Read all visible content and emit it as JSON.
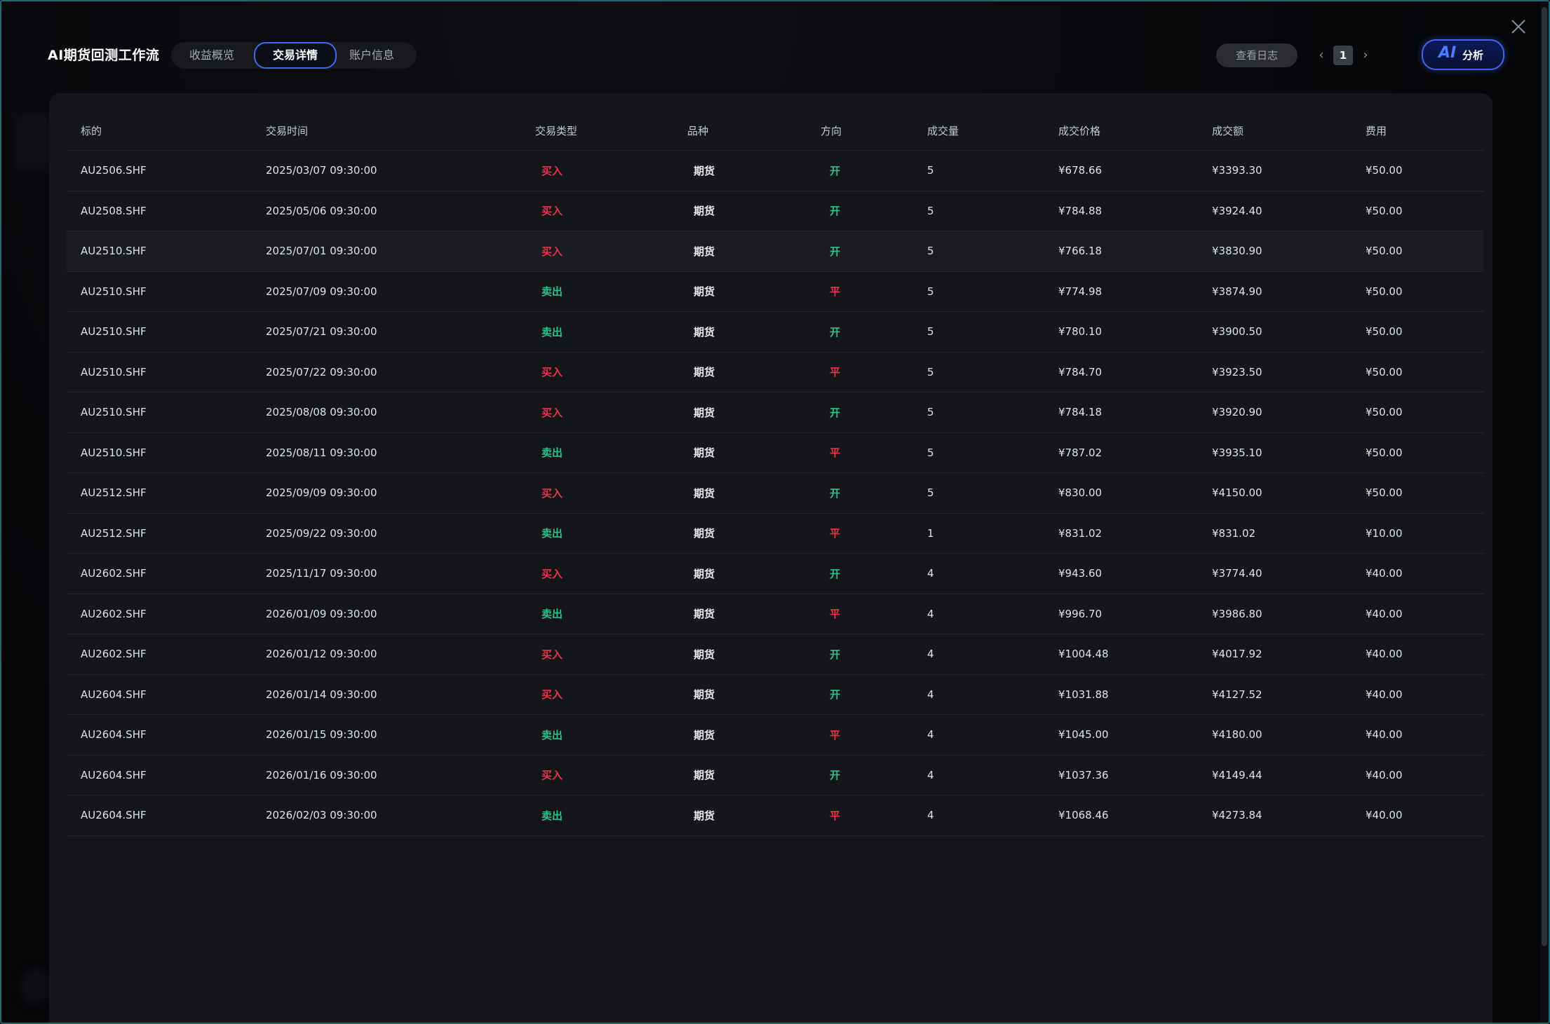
{
  "app": {
    "title": "AI期货回测工作流"
  },
  "tabs": [
    {
      "label": "收益概览",
      "active": false
    },
    {
      "label": "交易详情",
      "active": true
    },
    {
      "label": "账户信息",
      "active": false
    }
  ],
  "toolbar": {
    "log_label": "查看日志",
    "page": "1",
    "ai_mark": "AI",
    "ai_label": "分析",
    "close_icon": "close-icon"
  },
  "colors": {
    "buy": "#e8334a",
    "sell": "#27c48a",
    "accent": "#3d66f0",
    "open": "#27c48a",
    "close": "#e8334a"
  },
  "table": {
    "columns": [
      "标的",
      "交易时间",
      "交易类型",
      "品种",
      "方向",
      "成交量",
      "成交价格",
      "成交额",
      "费用"
    ],
    "rows": [
      [
        "AU2506.SHF",
        "2025/03/07 09:30:00",
        "买入",
        "期货",
        "开",
        "5",
        "¥678.66",
        "¥3393.30",
        "¥50.00"
      ],
      [
        "AU2508.SHF",
        "2025/05/06 09:30:00",
        "买入",
        "期货",
        "开",
        "5",
        "¥784.88",
        "¥3924.40",
        "¥50.00"
      ],
      [
        "AU2510.SHF",
        "2025/07/01 09:30:00",
        "买入",
        "期货",
        "开",
        "5",
        "¥766.18",
        "¥3830.90",
        "¥50.00"
      ],
      [
        "AU2510.SHF",
        "2025/07/09 09:30:00",
        "卖出",
        "期货",
        "平",
        "5",
        "¥774.98",
        "¥3874.90",
        "¥50.00"
      ],
      [
        "AU2510.SHF",
        "2025/07/21 09:30:00",
        "卖出",
        "期货",
        "开",
        "5",
        "¥780.10",
        "¥3900.50",
        "¥50.00"
      ],
      [
        "AU2510.SHF",
        "2025/07/22 09:30:00",
        "买入",
        "期货",
        "平",
        "5",
        "¥784.70",
        "¥3923.50",
        "¥50.00"
      ],
      [
        "AU2510.SHF",
        "2025/08/08 09:30:00",
        "买入",
        "期货",
        "开",
        "5",
        "¥784.18",
        "¥3920.90",
        "¥50.00"
      ],
      [
        "AU2510.SHF",
        "2025/08/11 09:30:00",
        "卖出",
        "期货",
        "平",
        "5",
        "¥787.02",
        "¥3935.10",
        "¥50.00"
      ],
      [
        "AU2512.SHF",
        "2025/09/09 09:30:00",
        "买入",
        "期货",
        "开",
        "5",
        "¥830.00",
        "¥4150.00",
        "¥50.00"
      ],
      [
        "AU2512.SHF",
        "2025/09/22 09:30:00",
        "卖出",
        "期货",
        "平",
        "1",
        "¥831.02",
        "¥831.02",
        "¥10.00"
      ],
      [
        "AU2602.SHF",
        "2025/11/17 09:30:00",
        "买入",
        "期货",
        "开",
        "4",
        "¥943.60",
        "¥3774.40",
        "¥40.00"
      ],
      [
        "AU2602.SHF",
        "2026/01/09 09:30:00",
        "卖出",
        "期货",
        "平",
        "4",
        "¥996.70",
        "¥3986.80",
        "¥40.00"
      ],
      [
        "AU2602.SHF",
        "2026/01/12 09:30:00",
        "买入",
        "期货",
        "开",
        "4",
        "¥1004.48",
        "¥4017.92",
        "¥40.00"
      ],
      [
        "AU2604.SHF",
        "2026/01/14 09:30:00",
        "买入",
        "期货",
        "开",
        "4",
        "¥1031.88",
        "¥4127.52",
        "¥40.00"
      ],
      [
        "AU2604.SHF",
        "2026/01/15 09:30:00",
        "卖出",
        "期货",
        "平",
        "4",
        "¥1045.00",
        "¥4180.00",
        "¥40.00"
      ],
      [
        "AU2604.SHF",
        "2026/01/16 09:30:00",
        "买入",
        "期货",
        "开",
        "4",
        "¥1037.36",
        "¥4149.44",
        "¥40.00"
      ],
      [
        "AU2604.SHF",
        "2026/02/03 09:30:00",
        "卖出",
        "期货",
        "平",
        "4",
        "¥1068.46",
        "¥4273.84",
        "¥40.00"
      ]
    ]
  }
}
